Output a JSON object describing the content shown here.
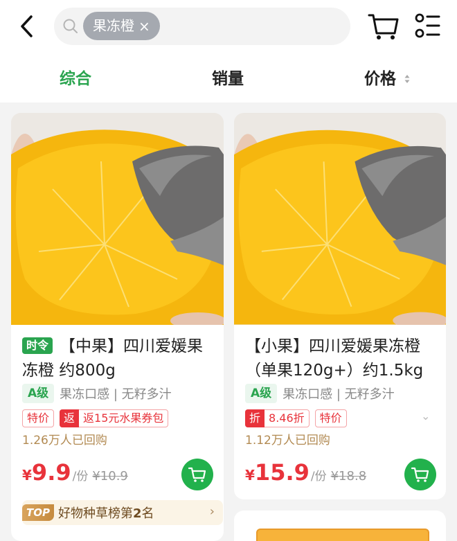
{
  "header": {
    "search_tag": "果冻橙",
    "tag_close": "×"
  },
  "sort_tabs": [
    {
      "label": "综合",
      "active": true
    },
    {
      "label": "销量",
      "active": false
    },
    {
      "label": "价格",
      "active": false
    }
  ],
  "products": [
    {
      "season_badge": "时令",
      "title": "【中果】四川爱媛果冻橙 约800g",
      "grade": "A级",
      "attributes": "果冻口感 | 无籽多汁",
      "promo_1": "特价",
      "promo_2_solid": "返",
      "promo_2_text": "返15元水果券包",
      "repurchase": "1.26万人已回购",
      "price_symbol": "¥",
      "price": "9.9",
      "unit": "/份",
      "original_price": "¥10.9",
      "rank_top": "TOP",
      "rank_pre": "好物种草榜第",
      "rank_num": "2",
      "rank_post": "名",
      "rank_arrow": "›"
    },
    {
      "title": "【小果】四川爱媛果冻橙（单果120g+）约1.5kg",
      "grade": "A级",
      "attributes": "果冻口感 | 无籽多汁",
      "promo_1_solid": "折",
      "promo_1_text": "8.46折",
      "promo_2": "特价",
      "repurchase": "1.12万人已回购",
      "price_symbol": "¥",
      "price": "15.9",
      "unit": "/份",
      "original_price": "¥18.8",
      "more": "⌄"
    }
  ],
  "colors": {
    "accent_green": "#2aa44f",
    "price_red": "#e8333b",
    "repurchase_gold": "#b28a52"
  }
}
